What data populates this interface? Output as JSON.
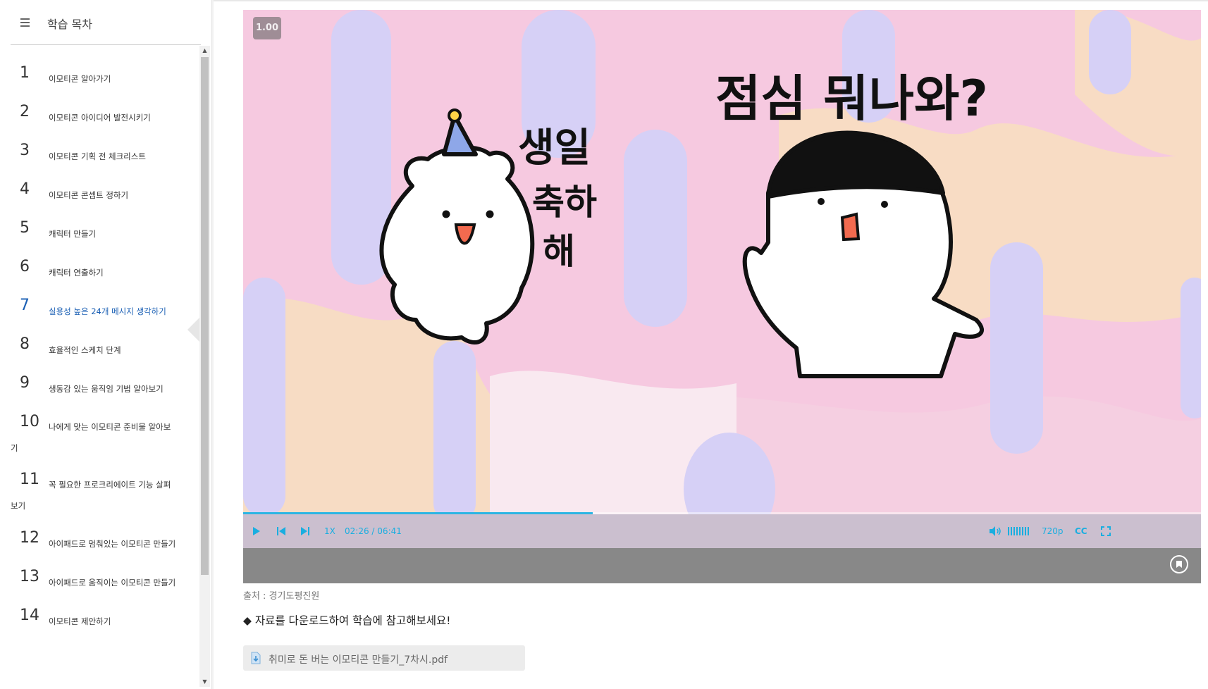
{
  "sidebar": {
    "title": "학습 목차",
    "items": [
      {
        "num": "1",
        "label": "이모티콘 알아가기"
      },
      {
        "num": "2",
        "label": "이모티콘 아이디어 발전시키기"
      },
      {
        "num": "3",
        "label": "이모티콘 기획 전 체크리스트"
      },
      {
        "num": "4",
        "label": "이모티콘 콘셉트 정하기"
      },
      {
        "num": "5",
        "label": "캐릭터 만들기"
      },
      {
        "num": "6",
        "label": "캐릭터 연출하기"
      },
      {
        "num": "7",
        "label": "실용성 높은 24개 메시지 생각하기",
        "active": true
      },
      {
        "num": "8",
        "label": "효율적인 스케치 단계"
      },
      {
        "num": "9",
        "label": "생동감 있는 움직임 기법 알아보기"
      },
      {
        "num": "10",
        "label": "나에게 맞는 이모티콘 준비물 알아보기"
      },
      {
        "num": "11",
        "label": "꼭 필요한 프로크리에이트 기능 살펴보기"
      },
      {
        "num": "12",
        "label": "아이패드로 멈춰있는 이모티콘 만들기"
      },
      {
        "num": "13",
        "label": "아이패드로 움직이는 이모티콘 만들기"
      },
      {
        "num": "14",
        "label": "이모티콘 제안하기"
      }
    ]
  },
  "player": {
    "speed_badge": "1.00",
    "speed_label": "1X",
    "current_time": "02:26",
    "time_separator": "/",
    "duration": "06:41",
    "progress": 0.365,
    "quality": "720p",
    "cc_label": "CC",
    "video_text": {
      "left_line1": "생일",
      "left_line2": "축하",
      "left_line3": "해",
      "right": "점심 뭐나와?"
    },
    "accent_color": "#19aee0"
  },
  "content": {
    "source": "출처 : 경기도평진원",
    "note": "◆ 자료를 다운로드하여 학습에 참고해보세요!",
    "file_name": "취미로 돈 버는 이모티콘 만들기_7차시.pdf"
  }
}
